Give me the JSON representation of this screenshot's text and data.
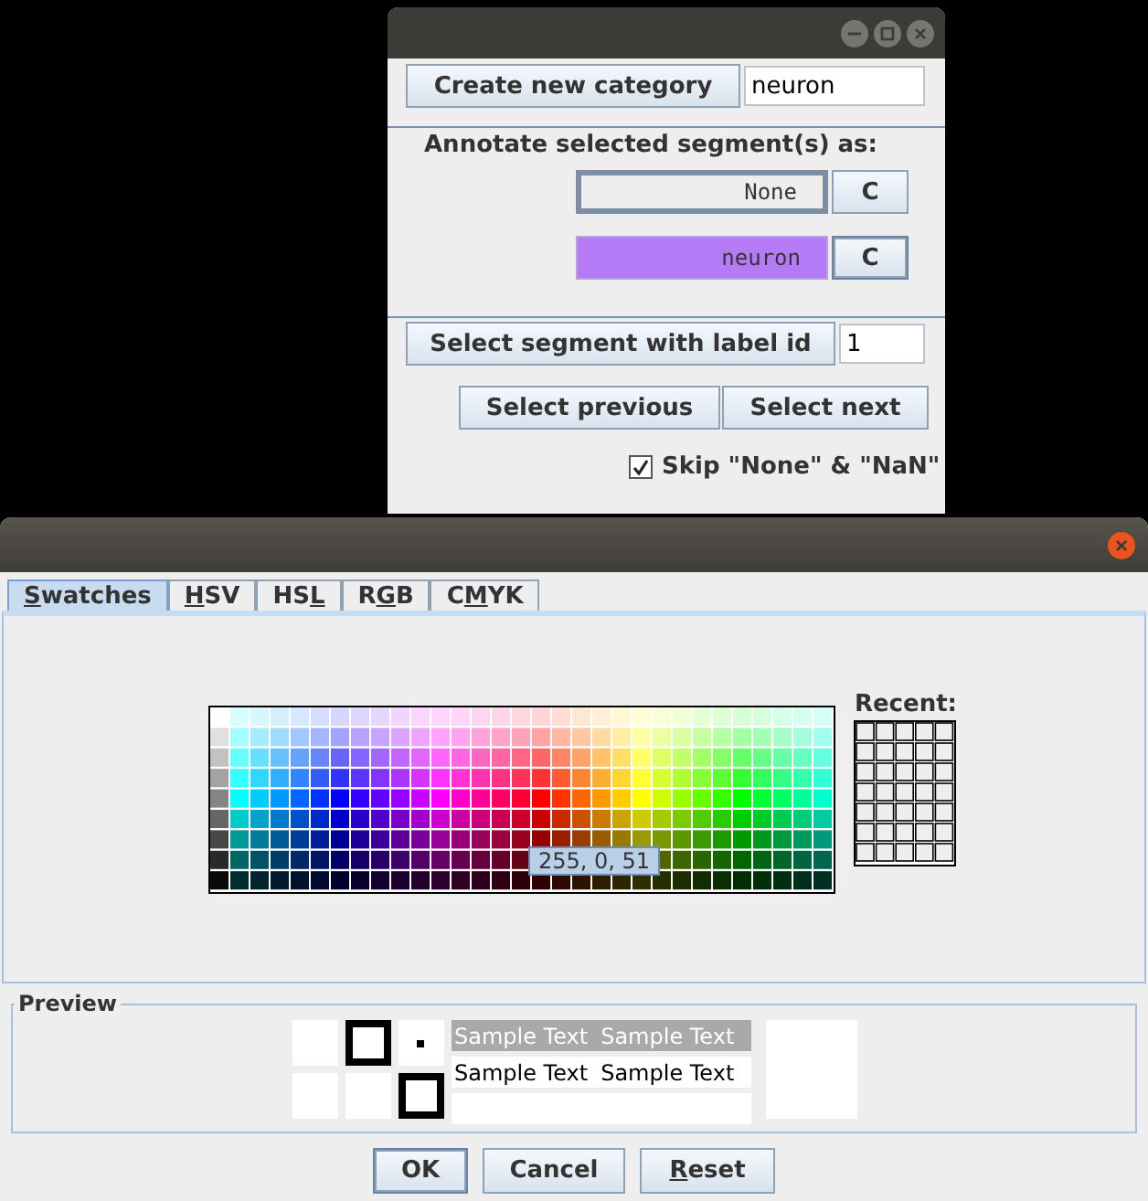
{
  "annotation_window": {
    "create_button": "Create new category",
    "category_field": "neuron",
    "annotate_label": "Annotate selected segment(s) as:",
    "categories": [
      {
        "name": "None",
        "selected": true,
        "color": "#eeeeee",
        "clear_button": "C"
      },
      {
        "name": "neuron",
        "selected": false,
        "color": "#b57bf7",
        "clear_button": "C"
      }
    ],
    "select_label_button": "Select segment with label id",
    "label_id_field": "1",
    "previous_button": "Select previous",
    "next_button": "Select next",
    "skip_checkbox": {
      "label": "Skip \"None\" & \"NaN\"",
      "checked": true
    }
  },
  "color_chooser": {
    "tabs": [
      {
        "key": "S",
        "after": "watches",
        "selected": true
      },
      {
        "key": "H",
        "after": "SV",
        "selected": false
      },
      {
        "before": "HS",
        "key": "L",
        "selected": false
      },
      {
        "before": "R",
        "key": "G",
        "after": "B",
        "selected": false
      },
      {
        "before": "C",
        "key": "M",
        "after": "YK",
        "selected": false
      }
    ],
    "recent_label": "Recent:",
    "tooltip": "255, 0, 51",
    "preview_title": "Preview",
    "sample_texts": [
      "Sample Text",
      "Sample Text",
      "Sample Text",
      "Sample Text"
    ],
    "buttons": [
      {
        "after": "OK",
        "default": true
      },
      {
        "after": "Cancel",
        "default": false
      },
      {
        "key": "R",
        "after": "eset",
        "default": false
      }
    ]
  }
}
